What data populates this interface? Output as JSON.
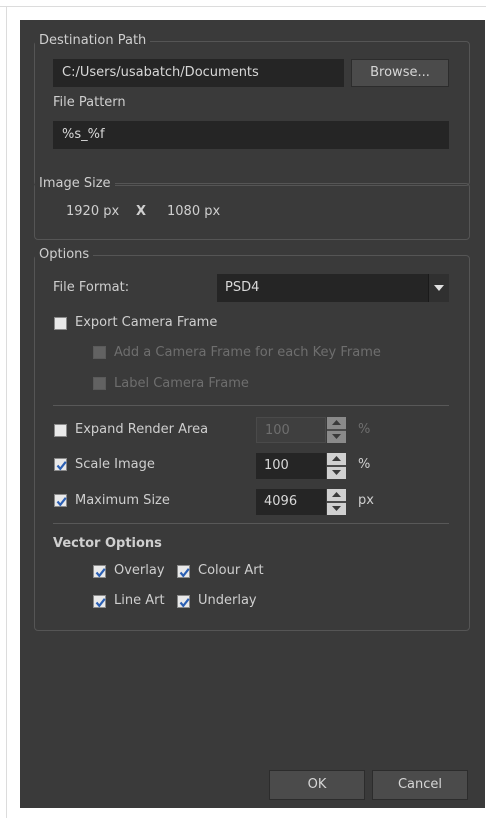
{
  "destination": {
    "title": "Destination Path",
    "path_value": "C:/Users/usabatch/Documents",
    "browse_label": "Browse...",
    "file_pattern_label": "File Pattern",
    "file_pattern_value": "%s_%f"
  },
  "image_size": {
    "title": "Image Size",
    "width": "1920 px",
    "separator": "X",
    "height": "1080 px"
  },
  "options": {
    "title": "Options",
    "file_format_label": "File Format:",
    "file_format_value": "PSD4",
    "export_camera_frame": {
      "label": "Export Camera Frame",
      "checked": false
    },
    "add_camera_frame": {
      "label": "Add a Camera Frame for each Key Frame",
      "checked": false,
      "enabled": false
    },
    "label_camera_frame": {
      "label": "Label Camera Frame",
      "checked": false,
      "enabled": false
    },
    "expand_render_area": {
      "label": "Expand Render Area",
      "checked": false,
      "value": "100",
      "unit": "%"
    },
    "scale_image": {
      "label": "Scale Image",
      "checked": true,
      "value": "100",
      "unit": "%"
    },
    "maximum_size": {
      "label": "Maximum Size",
      "checked": true,
      "value": "4096",
      "unit": "px"
    },
    "vector_options": {
      "title": "Vector Options",
      "overlay": {
        "label": "Overlay",
        "checked": true
      },
      "colour_art": {
        "label": "Colour Art",
        "checked": true
      },
      "line_art": {
        "label": "Line Art",
        "checked": true
      },
      "underlay": {
        "label": "Underlay",
        "checked": true
      }
    }
  },
  "footer": {
    "ok_label": "OK",
    "cancel_label": "Cancel"
  },
  "colors": {
    "dialog_bg": "#3a3a3a",
    "field_bg": "#252525",
    "text": "#cfcfcf",
    "disabled_text": "#6e6e6e",
    "checkbox_check": "#2b5fb3"
  }
}
